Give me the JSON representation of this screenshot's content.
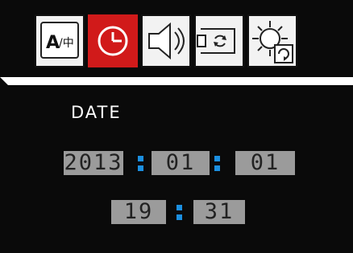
{
  "tabs": [
    {
      "name": "language",
      "icon": "language-icon",
      "glyph_a": "A",
      "glyph_b": "/中",
      "active": false
    },
    {
      "name": "clock",
      "icon": "clock-icon",
      "active": true
    },
    {
      "name": "audio",
      "icon": "speaker-icon",
      "active": false
    },
    {
      "name": "sync",
      "icon": "sync-icon",
      "active": false
    },
    {
      "name": "settings",
      "icon": "gear-reset-icon",
      "active": false
    }
  ],
  "colors": {
    "background": "#0a0a0a",
    "active_tab_border": "#d11a1a",
    "field_bg": "#9b9b9b",
    "separator_accent": "#1b8fe0"
  },
  "date_section": {
    "label": "DATE",
    "year": "2013",
    "month": "01",
    "day": "01"
  },
  "time_section": {
    "hour": "19",
    "minute": "31"
  }
}
